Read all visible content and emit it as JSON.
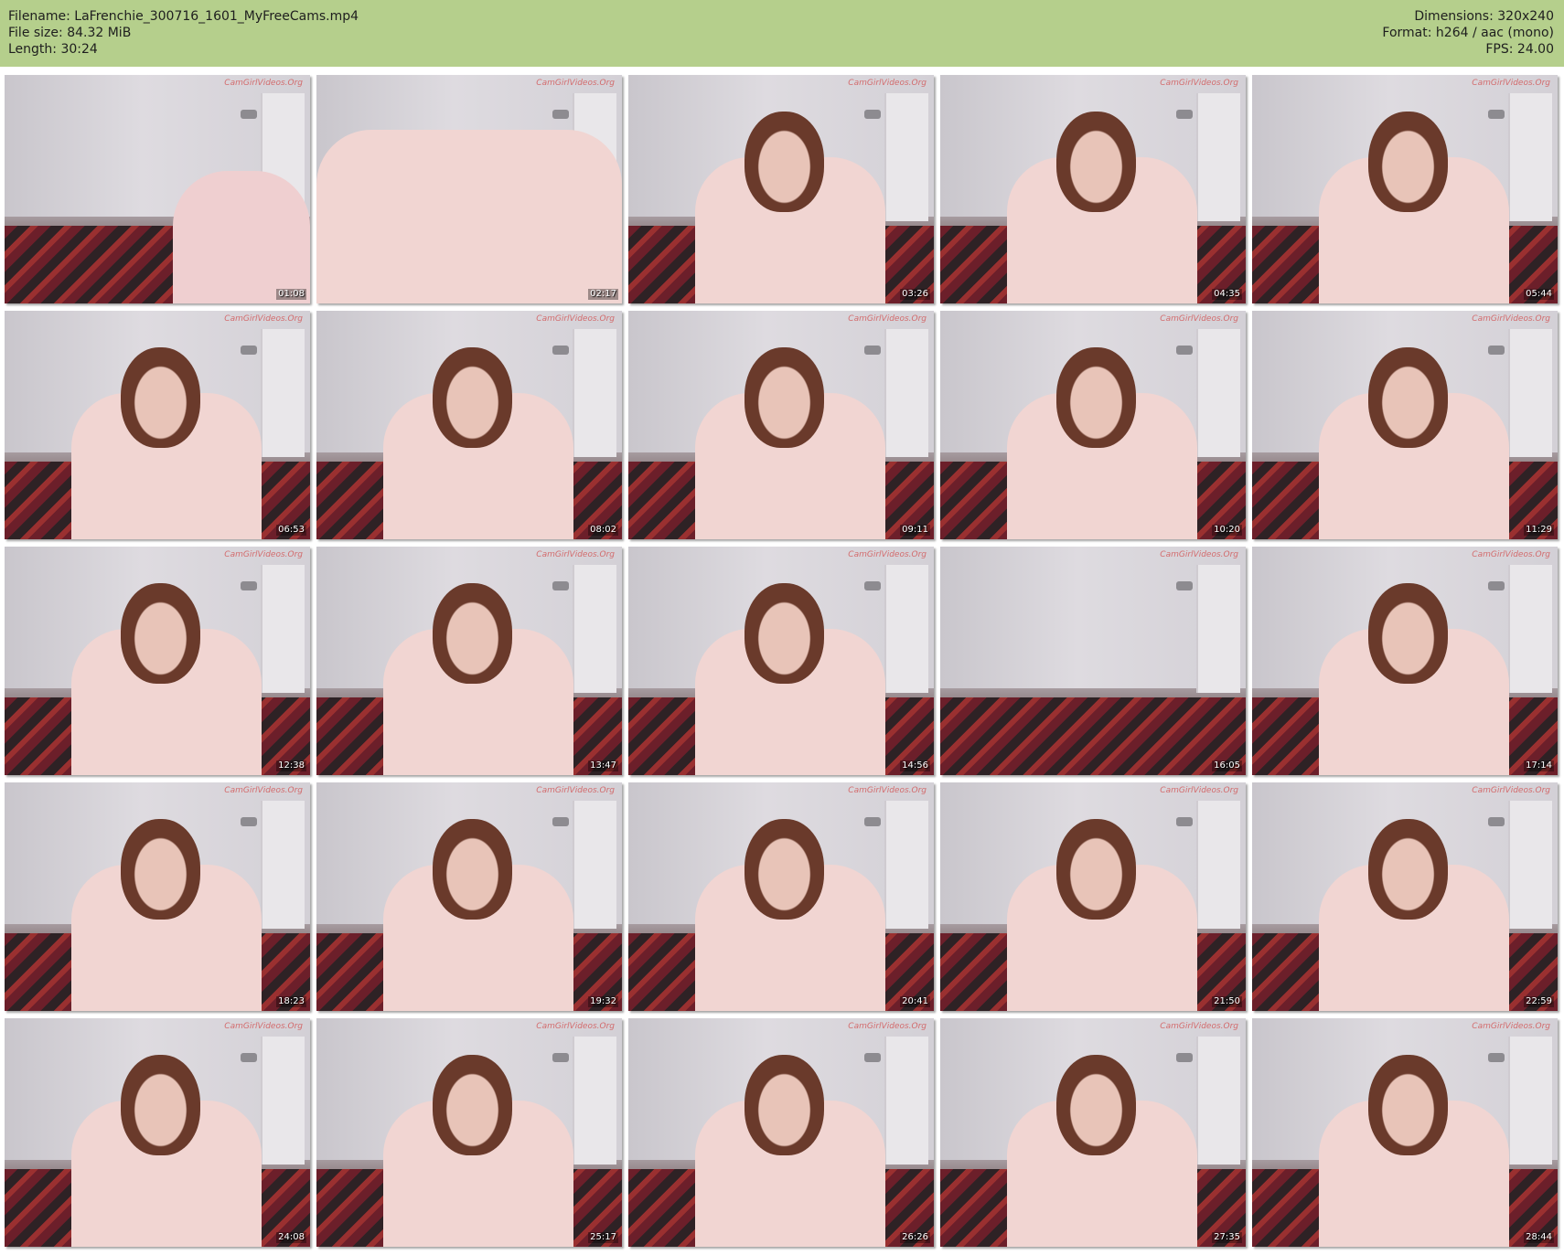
{
  "header": {
    "filename": "Filename: LaFrenchie_300716_1601_MyFreeCams.mp4",
    "filesize": "File size: 84.32 MiB",
    "length": "Length: 30:24",
    "dimensions": "Dimensions: 320x240",
    "format": "Format: h264 / aac (mono)",
    "fps": "FPS: 24.00"
  },
  "watermark": "CamGirlVideos.Org",
  "thumbnails": [
    {
      "time": "01:08"
    },
    {
      "time": "02:17"
    },
    {
      "time": "03:26"
    },
    {
      "time": "04:35"
    },
    {
      "time": "05:44"
    },
    {
      "time": "06:53"
    },
    {
      "time": "08:02"
    },
    {
      "time": "09:11"
    },
    {
      "time": "10:20"
    },
    {
      "time": "11:29"
    },
    {
      "time": "12:38"
    },
    {
      "time": "13:47"
    },
    {
      "time": "14:56"
    },
    {
      "time": "16:05"
    },
    {
      "time": "17:14"
    },
    {
      "time": "18:23"
    },
    {
      "time": "19:32"
    },
    {
      "time": "20:41"
    },
    {
      "time": "21:50"
    },
    {
      "time": "22:59"
    },
    {
      "time": "24:08"
    },
    {
      "time": "25:17"
    },
    {
      "time": "26:26"
    },
    {
      "time": "27:35"
    },
    {
      "time": "28:44"
    }
  ]
}
